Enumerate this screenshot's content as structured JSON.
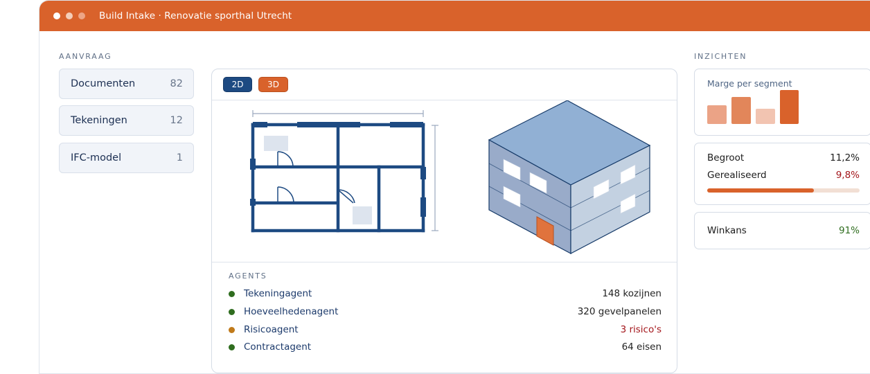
{
  "window": {
    "title": "Build Intake · Renovatie sporthal Utrecht"
  },
  "request": {
    "label": "AANVRAAG",
    "items": [
      {
        "label": "Documenten",
        "count": "82"
      },
      {
        "label": "Tekeningen",
        "count": "12"
      },
      {
        "label": "IFC-model",
        "count": "1"
      }
    ]
  },
  "viewer": {
    "modes": [
      "2D",
      "3D"
    ],
    "active_mode": "2D"
  },
  "agents": {
    "label": "AGENTS",
    "items": [
      {
        "name": "Tekeningagent",
        "value": "148 kozijnen",
        "status": "ok",
        "dot_color": "#2f6d1f",
        "value_color": "#222222"
      },
      {
        "name": "Hoeveelhedenagent",
        "value": "320 gevelpanelen",
        "status": "ok",
        "dot_color": "#2f6d1f",
        "value_color": "#222222"
      },
      {
        "name": "Risicoagent",
        "value": "3 risico's",
        "status": "warning",
        "dot_color": "#c07a1a",
        "value_color": "#a3151a"
      },
      {
        "name": "Contractagent",
        "value": "64 eisen",
        "status": "ok",
        "dot_color": "#2f6d1f",
        "value_color": "#222222"
      }
    ]
  },
  "insights": {
    "label": "INZICHTEN",
    "margin_chart": {
      "title": "Marge per segment",
      "bars": [
        {
          "level": 0.54,
          "color": "#eba386"
        },
        {
          "level": 0.78,
          "color": "#e2865a"
        },
        {
          "level": 0.43,
          "color": "#f2c4b1"
        },
        {
          "level": 0.98,
          "color": "#d9622b"
        }
      ]
    },
    "budget": {
      "planned_label": "Begroot",
      "planned_value": "11,2%",
      "realised_label": "Gerealiseerd",
      "realised_value": "9,8%",
      "progress": 0.7
    },
    "win": {
      "label": "Winkans",
      "value": "91%"
    }
  },
  "colors": {
    "accent": "#d9622b",
    "navy": "#1d4a82",
    "negative": "#a3151a",
    "positive": "#2f6d1f"
  }
}
